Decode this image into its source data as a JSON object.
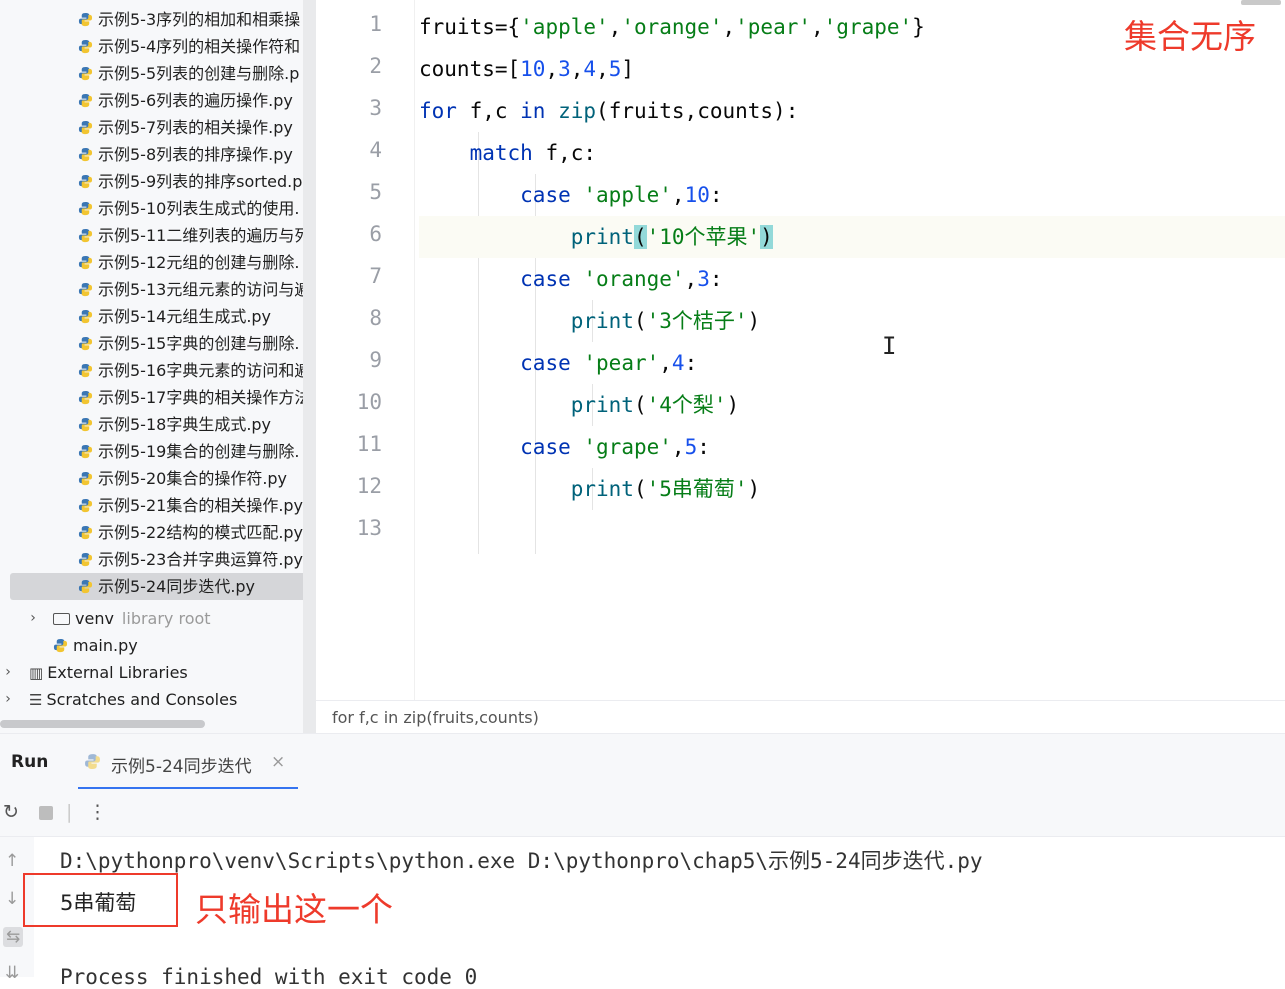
{
  "project_tree": {
    "files": [
      "示例5-3序列的相加和相乘操",
      "示例5-4序列的相关操作符和",
      "示例5-5列表的创建与删除.p",
      "示例5-6列表的遍历操作.py",
      "示例5-7列表的相关操作.py",
      "示例5-8列表的排序操作.py",
      "示例5-9列表的排序sorted.p",
      "示例5-10列表生成式的使用.",
      "示例5-11二维列表的遍历与列",
      "示例5-12元组的创建与删除.",
      "示例5-13元组元素的访问与遍",
      "示例5-14元组生成式.py",
      "示例5-15字典的创建与删除.",
      "示例5-16字典元素的访问和遍",
      "示例5-17字典的相关操作方法",
      "示例5-18字典生成式.py",
      "示例5-19集合的创建与删除.",
      "示例5-20集合的操作符.py",
      "示例5-21集合的相关操作.py",
      "示例5-22结构的模式匹配.py",
      "示例5-23合并字典运算符.py",
      "示例5-24同步迭代.py"
    ],
    "venv_label": "venv",
    "venv_hint": "library root",
    "main_file": "main.py",
    "external_libraries": "External Libraries",
    "scratches": "Scratches and Consoles"
  },
  "editor": {
    "line_numbers": [
      "1",
      "2",
      "3",
      "4",
      "5",
      "6",
      "7",
      "8",
      "9",
      "10",
      "11",
      "12",
      "13"
    ],
    "code": {
      "l1_a": "fruits={",
      "l1_s1": "'apple'",
      "l1_s2": "'orange'",
      "l1_s3": "'pear'",
      "l1_s4": "'grape'",
      "l1_end": "}",
      "l2_a": "counts=[",
      "l2_n1": "10",
      "l2_n2": "3",
      "l2_n3": "4",
      "l2_n4": "5",
      "l2_end": "]",
      "l3_kw1": "for",
      "l3_mid": " f,c ",
      "l3_kw2": "in",
      "l3_fn": "zip",
      "l3_args": "(fruits,counts):",
      "l4_kw": "match",
      "l4_rest": " f,c:",
      "case_kw": "case",
      "l5_s": "'apple'",
      "l5_n": "10",
      "print_fn": "print",
      "l6_s": "'10个苹果'",
      "l7_s": "'orange'",
      "l7_n": "3",
      "l8_s": "'3个桔子'",
      "l9_s": "'pear'",
      "l9_n": "4",
      "l10_s": "'4个梨'",
      "l11_s": "'grape'",
      "l11_n": "5",
      "l12_s": "'5串葡萄'"
    },
    "annotation": "集合无序",
    "breadcrumb": "for f,c in zip(fruits,counts)"
  },
  "run": {
    "label": "Run",
    "tab_label": "示例5-24同步迭代",
    "command": "D:\\pythonpro\\venv\\Scripts\\python.exe D:\\pythonpro\\chap5\\示例5-24同步迭代.py",
    "output": "5串葡萄",
    "annotation": "只输出这一个",
    "process_finished": "Process finished with exit code 0"
  },
  "colors": {
    "annotation_red": "#ee3a2b",
    "keyword": "#0033b3",
    "string": "#067d17",
    "number": "#1750eb",
    "function": "#00627a",
    "tab_underline": "#3574f0"
  },
  "icons": {
    "python_file": "python-file-icon",
    "folder": "folder-icon",
    "library": "library-icon",
    "scratches": "scratches-icon",
    "rerun": "rerun-icon",
    "stop": "stop-icon",
    "more": "more-icon",
    "up": "arrow-up-icon",
    "down": "arrow-down-icon",
    "wrap": "soft-wrap-icon",
    "scroll_end": "scroll-to-end-icon"
  }
}
